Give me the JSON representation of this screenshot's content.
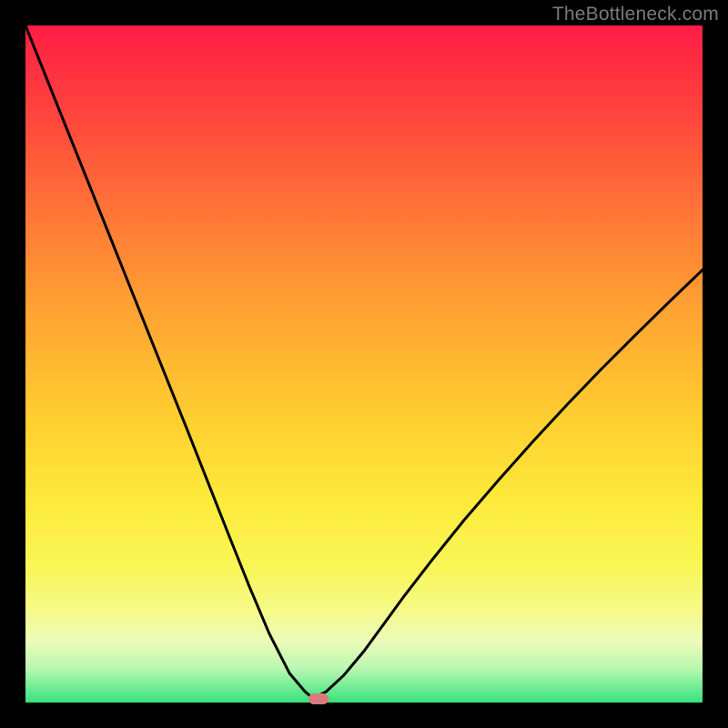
{
  "watermark": "TheBottleneck.com",
  "chart_data": {
    "type": "line",
    "title": "",
    "xlabel": "",
    "ylabel": "",
    "xlim": [
      0,
      100
    ],
    "ylim": [
      0,
      100
    ],
    "x": [
      0,
      3,
      6,
      9,
      12,
      15,
      18,
      21,
      24,
      27,
      30,
      33,
      36,
      39,
      41.3,
      42.5,
      44.4,
      47,
      50,
      53,
      56,
      60,
      65,
      70,
      75,
      80,
      85,
      90,
      95,
      100
    ],
    "values": [
      100,
      92.5,
      85,
      77.5,
      70,
      62.5,
      55,
      47.5,
      40,
      32.4,
      24.8,
      17.3,
      10.2,
      4.3,
      1.6,
      0.6,
      1.6,
      4.0,
      7.6,
      11.7,
      15.8,
      21.0,
      27.2,
      33.0,
      38.6,
      44.0,
      49.2,
      54.2,
      59.1,
      63.9
    ],
    "marker": {
      "x": 43.3,
      "y": 0.6
    },
    "note": "Values are estimated from the plotted polyline; the image has no visible axes or tick labels."
  },
  "colors": {
    "curve": "#000000",
    "marker": "#da7a7d",
    "gradient_top": "#ff1d45",
    "gradient_bottom": "#35e37b",
    "frame": "#000000",
    "watermark": "#7a7a7a"
  }
}
